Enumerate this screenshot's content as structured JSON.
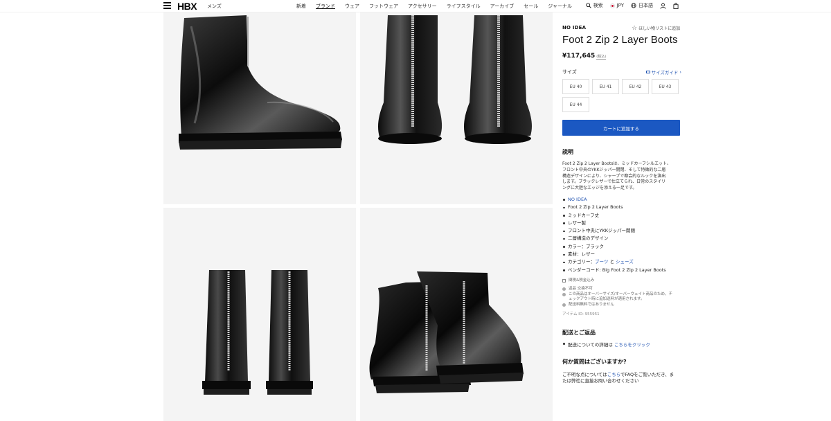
{
  "header": {
    "logo": "HBX",
    "gender": "メンズ",
    "nav": [
      "新着",
      "ブランド",
      "ウェア",
      "フットウェア",
      "アクセサリー",
      "ライフスタイル",
      "アーカイブ",
      "セール",
      "ジャーナル"
    ],
    "active_nav": "ブランド",
    "search": "検索",
    "currency": "JPY",
    "language": "日本語"
  },
  "product": {
    "brand": "NO IDEA",
    "wishlist": "ほしい物リストに追加",
    "title": "Foot 2 Zip 2 Layer Boots",
    "price": "¥117,645",
    "tax_note": "(税込)",
    "size_label": "サイズ",
    "size_guide": "サイズガイド",
    "sizes": [
      "EU 40",
      "EU 41",
      "EU 42",
      "EU 43",
      "EU 44"
    ],
    "add_to_cart": "カートに追加する"
  },
  "description": {
    "heading": "説明",
    "lines": [
      "Foot 2 Zip 2 Layer Bootsは、ミッドカーフシルエット、",
      "フロント中央のYKKジッパー開閉、そして特徴的な二層",
      "構造デザインにより、シャープで都会的なルックを演出",
      "します。ブラックレザーで仕立てられ、日常のスタイリ",
      "ングに大胆なエッジを添える一足です。"
    ],
    "bullets": {
      "brand_link": "NO IDEA",
      "name": "Foot 2 Zip 2 Layer Boots",
      "height": "ミッドカーフ丈",
      "material_type": "レザー製",
      "closure": "フロント中央にYKKジッパー開閉",
      "construction": "二層構造のデザイン",
      "color": "カラー：ブラック",
      "material": "素材：レザー",
      "category_prefix": "カテゴリー：",
      "category_1": "ブーツ",
      "category_and": " と ",
      "category_2": "シューズ",
      "vendor_code": "ベンダーコード: Big Foot 2 Zip 2 Layer Boots"
    },
    "customs": "関税&税金込み",
    "notes": [
      "返品 交換不可",
      "この商品はオーバーサイズ/オーバーウェイト商品のため、チ",
      "ェックアウト時に追加送料が適用されます。",
      "配送料無料ではありません"
    ],
    "item_id": "アイテム ID: 955951"
  },
  "shipping": {
    "heading": "配送とご返品",
    "text": "配送についての詳細は ",
    "link": "こちらをクリック"
  },
  "questions": {
    "heading": "何か質問はございますか?",
    "line1_prefix": "ご不明な点については",
    "line1_link": "こちら",
    "line1_suffix": "でFAQをご覧いただき、ま",
    "line2": "たは弊社に直接お問い合わせください"
  }
}
